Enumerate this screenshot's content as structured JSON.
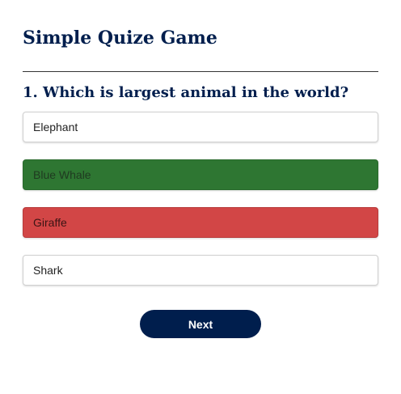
{
  "app": {
    "title": "Simple Quize Game"
  },
  "quiz": {
    "question": "1. Which is largest animal in the world?",
    "answers": [
      {
        "label": "Elephant",
        "state": "neutral"
      },
      {
        "label": "Blue Whale",
        "state": "correct"
      },
      {
        "label": "Giraffe",
        "state": "incorrect"
      },
      {
        "label": "Shark",
        "state": "neutral"
      }
    ],
    "next_label": "Next"
  },
  "colors": {
    "heading": "#001e4d",
    "correct": "#2e7632",
    "incorrect": "#d24646",
    "button": "#001e4d"
  }
}
